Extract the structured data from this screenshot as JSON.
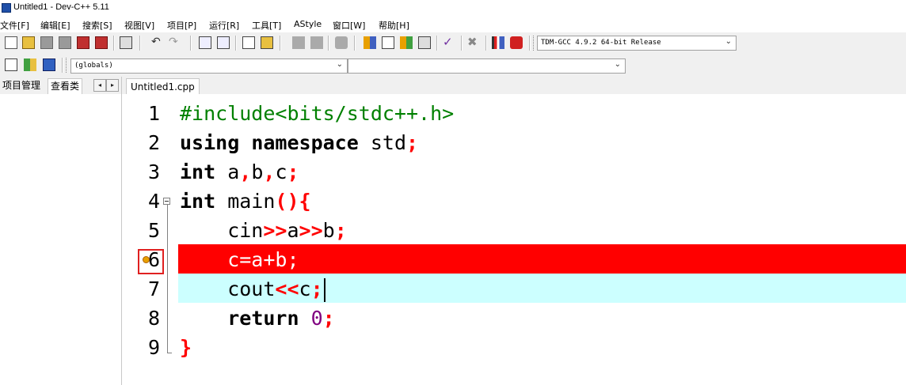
{
  "window": {
    "title": "Untitled1 - Dev-C++ 5.11"
  },
  "menu": [
    "文件[F]",
    "编辑[E]",
    "搜索[S]",
    "视图[V]",
    "项目[P]",
    "运行[R]",
    "工具[T]",
    "AStyle",
    "窗口[W]",
    "帮助[H]"
  ],
  "toolbar": {
    "compiler": "TDM-GCC 4.9.2 64-bit Release"
  },
  "toolbar2": {
    "scope": "(globals)",
    "symbol": ""
  },
  "left_panel": {
    "tabs": [
      "项目管理",
      "查看类"
    ],
    "nav_prev": "◂",
    "nav_next": "▸"
  },
  "editor": {
    "tab": "Untitled1.cpp",
    "line_numbers": [
      "1",
      "2",
      "3",
      "4",
      "5",
      "6",
      "7",
      "8",
      "9"
    ],
    "lines": [
      {
        "segments": [
          {
            "t": "#include<bits/stdc++.h>",
            "c": "pp"
          }
        ]
      },
      {
        "segments": [
          {
            "t": "using",
            "c": "kw"
          },
          {
            "t": " "
          },
          {
            "t": "namespace",
            "c": "kw"
          },
          {
            "t": " std"
          },
          {
            "t": ";",
            "c": "sym"
          }
        ]
      },
      {
        "segments": [
          {
            "t": "int",
            "c": "kw"
          },
          {
            "t": " a"
          },
          {
            "t": ",",
            "c": "sym"
          },
          {
            "t": "b"
          },
          {
            "t": ",",
            "c": "sym"
          },
          {
            "t": "c"
          },
          {
            "t": ";",
            "c": "sym"
          }
        ]
      },
      {
        "segments": [
          {
            "t": "int",
            "c": "kw"
          },
          {
            "t": " main"
          },
          {
            "t": "(){",
            "c": "sym"
          }
        ]
      },
      {
        "segments": [
          {
            "t": "    cin"
          },
          {
            "t": ">>",
            "c": "sym"
          },
          {
            "t": "a"
          },
          {
            "t": ">>",
            "c": "sym"
          },
          {
            "t": "b"
          },
          {
            "t": ";",
            "c": "sym"
          }
        ]
      },
      {
        "segments": [
          {
            "t": "    c=a+b;",
            "c": "plainwhite"
          }
        ]
      },
      {
        "segments": [
          {
            "t": "    cout"
          },
          {
            "t": "<<",
            "c": "sym"
          },
          {
            "t": "c"
          },
          {
            "t": ";",
            "c": "sym"
          }
        ]
      },
      {
        "segments": [
          {
            "t": "    "
          },
          {
            "t": "return",
            "c": "kw"
          },
          {
            "t": " "
          },
          {
            "t": "0",
            "c": "num"
          },
          {
            "t": ";",
            "c": "sym"
          }
        ]
      },
      {
        "segments": [
          {
            "t": "}",
            "c": "sym"
          }
        ]
      }
    ],
    "breakpoint_line": 6,
    "current_line": 7,
    "colors": {
      "breakpoint": "#ff0000",
      "current_line": "#ccffff",
      "preprocessor": "#008000",
      "symbol": "#ff0000",
      "number": "#800080"
    }
  }
}
